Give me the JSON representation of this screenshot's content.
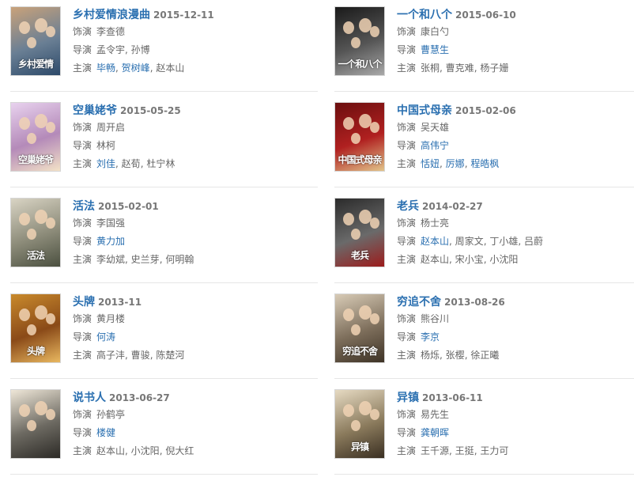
{
  "items": [
    {
      "title": "乡村爱情浪漫曲",
      "date": "2015-12-11",
      "actor_label": "饰演",
      "actor": "李查德",
      "director_label": "导演",
      "directors": [
        {
          "n": "孟令宇",
          "link": false
        },
        {
          "n": "孙博",
          "link": false
        }
      ],
      "cast_label": "主演",
      "cast": [
        {
          "n": "毕畅",
          "link": true
        },
        {
          "n": "贺树峰",
          "link": true
        },
        {
          "n": "赵本山",
          "link": false
        }
      ],
      "poster_text": "乡村爱情",
      "poster_colors": [
        "#c9a27a",
        "#6a7f94",
        "#2d4a6a"
      ]
    },
    {
      "title": "一个和八个",
      "date": "2015-06-10",
      "actor_label": "饰演",
      "actor": "康白勺",
      "director_label": "导演",
      "directors": [
        {
          "n": "曹慧生",
          "link": true
        }
      ],
      "cast_label": "主演",
      "cast": [
        {
          "n": "张桐",
          "link": false
        },
        {
          "n": "曹克难",
          "link": false
        },
        {
          "n": "杨子姗",
          "link": false
        }
      ],
      "poster_text": "一个和八个",
      "poster_colors": [
        "#1a1a1a",
        "#555555",
        "#a9a9a9"
      ]
    },
    {
      "title": "空巢姥爷",
      "date": "2015-05-25",
      "actor_label": "饰演",
      "actor": "周开启",
      "director_label": "导演",
      "directors": [
        {
          "n": "林柯",
          "link": false
        }
      ],
      "cast_label": "主演",
      "cast": [
        {
          "n": "刘佳",
          "link": true
        },
        {
          "n": "赵荀",
          "link": false
        },
        {
          "n": "杜宁林",
          "link": false
        }
      ],
      "poster_text": "空巢姥爷",
      "poster_colors": [
        "#e8d2ee",
        "#b48ab9",
        "#f3e2c7"
      ]
    },
    {
      "title": "中国式母亲",
      "date": "2015-02-06",
      "actor_label": "饰演",
      "actor": "吴天雄",
      "director_label": "导演",
      "directors": [
        {
          "n": "高伟宁",
          "link": true
        }
      ],
      "cast_label": "主演",
      "cast": [
        {
          "n": "恬妞",
          "link": true
        },
        {
          "n": "厉娜",
          "link": true
        },
        {
          "n": "程皓枫",
          "link": true
        }
      ],
      "poster_text": "中国式母亲",
      "poster_colors": [
        "#6b0f0f",
        "#b02020",
        "#e2c48a"
      ]
    },
    {
      "title": "活法",
      "date": "2015-02-01",
      "actor_label": "饰演",
      "actor": "李国强",
      "director_label": "导演",
      "directors": [
        {
          "n": "黄力加",
          "link": true
        }
      ],
      "cast_label": "主演",
      "cast": [
        {
          "n": "李幼斌",
          "link": false
        },
        {
          "n": "史兰芽",
          "link": false
        },
        {
          "n": "何明翰",
          "link": false
        }
      ],
      "poster_text": "活法",
      "poster_colors": [
        "#d9d4c4",
        "#8d8c7a",
        "#4b5040"
      ]
    },
    {
      "title": "老兵",
      "date": "2014-02-27",
      "actor_label": "饰演",
      "actor": "杨士亮",
      "director_label": "导演",
      "directors": [
        {
          "n": "赵本山",
          "link": true
        },
        {
          "n": "周家文",
          "link": false
        },
        {
          "n": "丁小雄",
          "link": false
        },
        {
          "n": "吕蔚",
          "link": false
        }
      ],
      "cast_label": "主演",
      "cast": [
        {
          "n": "赵本山",
          "link": false
        },
        {
          "n": "宋小宝",
          "link": false
        },
        {
          "n": "小沈阳",
          "link": false
        }
      ],
      "poster_text": "老兵",
      "poster_colors": [
        "#2b2b2b",
        "#6a6a6a",
        "#9c1c1c"
      ]
    },
    {
      "title": "头牌",
      "date": "2013-11",
      "actor_label": "饰演",
      "actor": "黄月楼",
      "director_label": "导演",
      "directors": [
        {
          "n": "何涛",
          "link": true
        }
      ],
      "cast_label": "主演",
      "cast": [
        {
          "n": "高子沣",
          "link": false
        },
        {
          "n": "曹骏",
          "link": false
        },
        {
          "n": "陈楚河",
          "link": false
        }
      ],
      "poster_text": "头牌",
      "poster_colors": [
        "#c98a2c",
        "#8a4a18",
        "#e9b860"
      ]
    },
    {
      "title": "穷追不舍",
      "date": "2013-08-26",
      "actor_label": "饰演",
      "actor": "熊谷川",
      "director_label": "导演",
      "directors": [
        {
          "n": "李京",
          "link": true
        }
      ],
      "cast_label": "主演",
      "cast": [
        {
          "n": "杨烁",
          "link": false
        },
        {
          "n": "张樱",
          "link": false
        },
        {
          "n": "徐正曦",
          "link": false
        }
      ],
      "poster_text": "穷追不舍",
      "poster_colors": [
        "#d8cbb6",
        "#7d6e5b",
        "#3e3326"
      ]
    },
    {
      "title": "说书人",
      "date": "2013-06-27",
      "actor_label": "饰演",
      "actor": "孙鹤亭",
      "director_label": "导演",
      "directors": [
        {
          "n": "楼健",
          "link": true
        }
      ],
      "cast_label": "主演",
      "cast": [
        {
          "n": "赵本山",
          "link": false
        },
        {
          "n": "小沈阳",
          "link": false
        },
        {
          "n": "倪大红",
          "link": false
        }
      ],
      "poster_text": "",
      "poster_colors": [
        "#efe7d8",
        "#6d6a62",
        "#2c2a26"
      ]
    },
    {
      "title": "异镇",
      "date": "2013-06-11",
      "actor_label": "饰演",
      "actor": "易先生",
      "director_label": "导演",
      "directors": [
        {
          "n": "龚朝晖",
          "link": true
        }
      ],
      "cast_label": "主演",
      "cast": [
        {
          "n": "王千源",
          "link": false
        },
        {
          "n": "王挺",
          "link": false
        },
        {
          "n": "王力可",
          "link": false
        }
      ],
      "poster_text": "异镇",
      "poster_colors": [
        "#e6dac2",
        "#8a7a5c",
        "#3a2f22"
      ]
    }
  ]
}
